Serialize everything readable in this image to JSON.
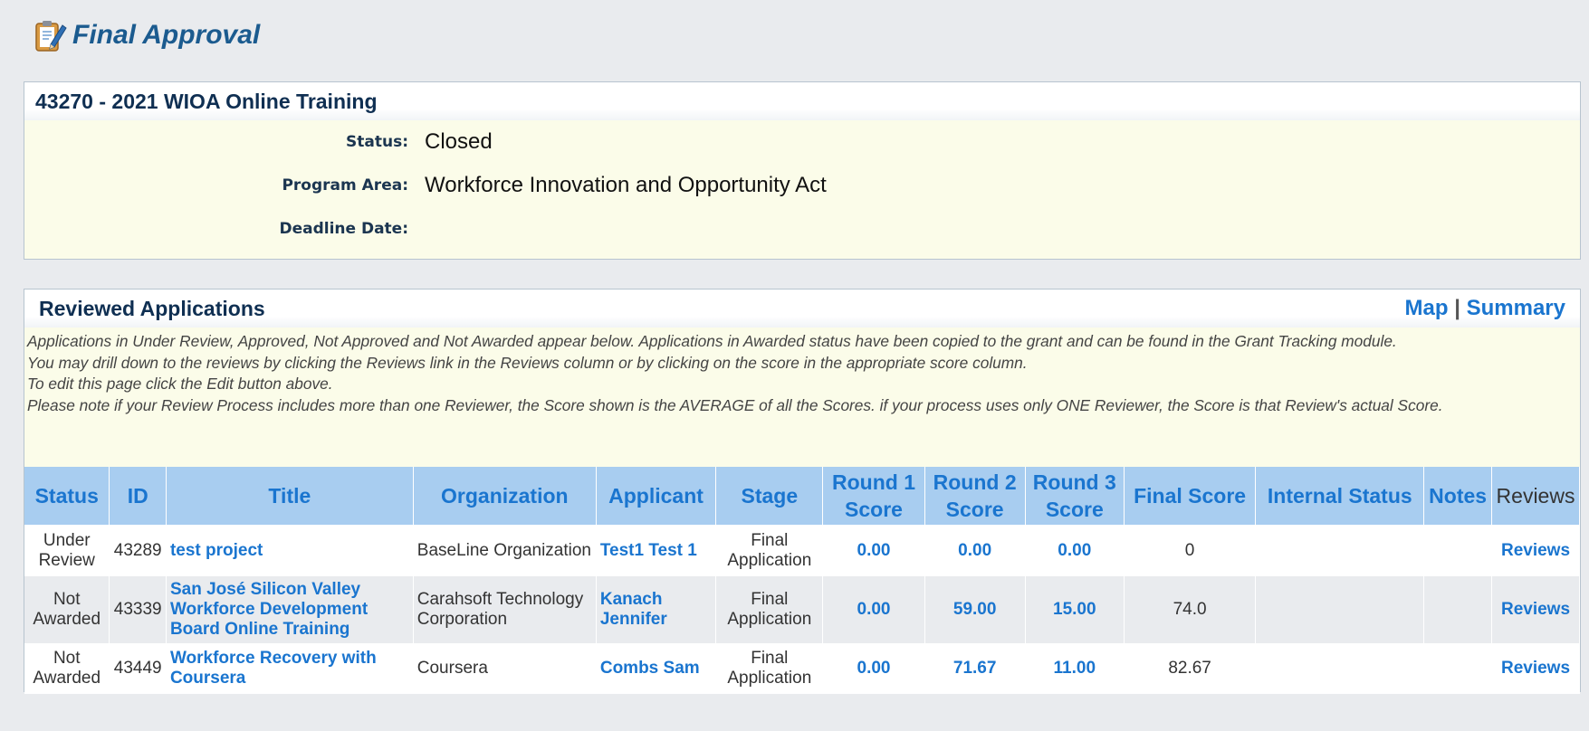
{
  "page": {
    "title": "Final Approval"
  },
  "summary": {
    "heading": "43270 - 2021 WIOA Online Training",
    "fields": [
      {
        "label": "Status:",
        "value": "Closed"
      },
      {
        "label": "Program Area:",
        "value": "Workforce Innovation and Opportunity Act"
      },
      {
        "label": "Deadline Date:",
        "value": ""
      }
    ]
  },
  "reviewed": {
    "heading": "Reviewed Applications",
    "map_link": "Map",
    "separator": "|",
    "summary_link": "Summary",
    "notes": [
      "Applications in Under Review, Approved, Not Approved and Not Awarded appear below. Applications in Awarded status have been copied to the grant and can be found in the Grant Tracking module.",
      "You may drill down to the reviews by clicking the Reviews link in the Reviews column or by clicking on the score in the appropriate score column.",
      "To edit this page click the Edit button above.",
      "Please note if your Review Process includes more than one Reviewer, the Score shown is the AVERAGE of all the Scores. if your process uses only ONE Reviewer, the Score is that Review's actual Score."
    ],
    "columns": [
      "Status",
      "ID",
      "Title",
      "Organization",
      "Applicant",
      "Stage",
      "Round 1 Score",
      "Round 2 Score",
      "Round 3 Score",
      "Final Score",
      "Internal Status",
      "Notes",
      "Reviews"
    ],
    "rows": [
      {
        "status": "Under Review",
        "id": "43289",
        "title": "test project",
        "organization": "BaseLine Organization",
        "applicant": "Test1 Test 1",
        "stage": "Final Application",
        "round1": "0.00",
        "round2": "0.00",
        "round3": "0.00",
        "final": "0",
        "internal_status": "",
        "notes": "",
        "reviews": "Reviews"
      },
      {
        "status": "Not Awarded",
        "id": "43339",
        "title": "San José Silicon Valley Workforce Development Board Online Training",
        "organization": "Carahsoft Technology Corporation",
        "applicant": "Kanach Jennifer",
        "stage": "Final Application",
        "round1": "0.00",
        "round2": "59.00",
        "round3": "15.00",
        "final": "74.0",
        "internal_status": "",
        "notes": "",
        "reviews": "Reviews"
      },
      {
        "status": "Not Awarded",
        "id": "43449",
        "title": "Workforce Recovery with Coursera",
        "organization": "Coursera",
        "applicant": "Combs Sam",
        "stage": "Final Application",
        "round1": "0.00",
        "round2": "71.67",
        "round3": "11.00",
        "final": "82.67",
        "internal_status": "",
        "notes": "",
        "reviews": "Reviews"
      }
    ]
  },
  "icons": {
    "page_icon": "clipboard-pencil-icon"
  }
}
